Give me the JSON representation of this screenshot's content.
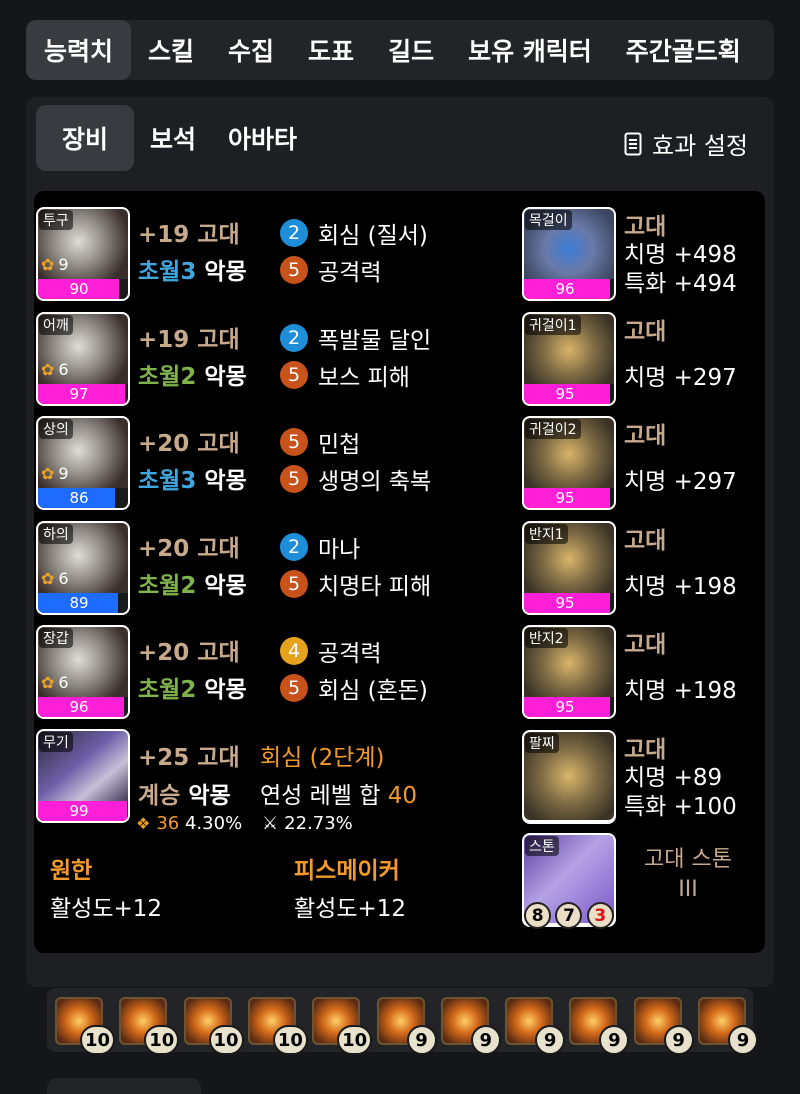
{
  "top_tabs": [
    "능력치",
    "스킬",
    "수집",
    "도표",
    "길드",
    "보유 캐릭터",
    "주간골드획"
  ],
  "sub_tabs": [
    "장비",
    "보석",
    "아바타"
  ],
  "effect_button": "효과 설정",
  "equipment": [
    {
      "slot": "투구",
      "level": "9",
      "quality": 90,
      "bar_color": "#ff1fd6",
      "upgrade": "+19",
      "grade": "고대",
      "transcend": "초월3",
      "transcend_color": "blue",
      "elixir_set": "악몽",
      "engravings": [
        {
          "level": "2",
          "name": "회심 (질서)",
          "color": "b"
        },
        {
          "level": "5",
          "name": "공격력",
          "color": "o"
        }
      ]
    },
    {
      "slot": "어깨",
      "level": "6",
      "quality": 97,
      "bar_color": "#ff1fd6",
      "upgrade": "+19",
      "grade": "고대",
      "transcend": "초월2",
      "transcend_color": "green",
      "elixir_set": "악몽",
      "engravings": [
        {
          "level": "2",
          "name": "폭발물 달인",
          "color": "b"
        },
        {
          "level": "5",
          "name": "보스 피해",
          "color": "o"
        }
      ]
    },
    {
      "slot": "상의",
      "level": "9",
      "quality": 86,
      "bar_color": "#1e6bff",
      "upgrade": "+20",
      "grade": "고대",
      "transcend": "초월3",
      "transcend_color": "blue",
      "elixir_set": "악몽",
      "engravings": [
        {
          "level": "5",
          "name": "민첩",
          "color": "o"
        },
        {
          "level": "5",
          "name": "생명의 축복",
          "color": "o"
        }
      ]
    },
    {
      "slot": "하의",
      "level": "6",
      "quality": 89,
      "bar_color": "#1e6bff",
      "upgrade": "+20",
      "grade": "고대",
      "transcend": "초월2",
      "transcend_color": "green",
      "elixir_set": "악몽",
      "engravings": [
        {
          "level": "2",
          "name": "마나",
          "color": "b"
        },
        {
          "level": "5",
          "name": "치명타 피해",
          "color": "o"
        }
      ]
    },
    {
      "slot": "장갑",
      "level": "6",
      "quality": 96,
      "bar_color": "#ff1fd6",
      "upgrade": "+20",
      "grade": "고대",
      "transcend": "초월2",
      "transcend_color": "green",
      "elixir_set": "악몽",
      "engravings": [
        {
          "level": "4",
          "name": "공격력",
          "color": "y"
        },
        {
          "level": "5",
          "name": "회심 (혼돈)",
          "color": "o"
        }
      ]
    }
  ],
  "weapon": {
    "slot": "무기",
    "quality": 99,
    "bar_color": "#ff1fd6",
    "upgrade": "+25",
    "grade": "고대",
    "effect": "회심 (2단계)",
    "succession": "계승",
    "elixir_set": "악몽",
    "yeonseong_label": "연성 레벨 합",
    "yeonseong_value": "40",
    "stat1_num": "36",
    "stat1_pct": "4.30%",
    "stat2_pct": "22.73%"
  },
  "sets": [
    {
      "name": "원한",
      "value": "활성도+12"
    },
    {
      "name": "피스메이커",
      "value": "활성도+12"
    }
  ],
  "accessories": [
    {
      "slot": "목걸이",
      "quality": 96,
      "grade": "고대",
      "stats": [
        "치명 +498",
        "특화 +494"
      ],
      "img": "neck"
    },
    {
      "slot": "귀걸이1",
      "quality": 95,
      "grade": "고대",
      "stats": [
        "치명 +297"
      ],
      "img": "acc"
    },
    {
      "slot": "귀걸이2",
      "quality": 95,
      "grade": "고대",
      "stats": [
        "치명 +297"
      ],
      "img": "acc"
    },
    {
      "slot": "반지1",
      "quality": 95,
      "grade": "고대",
      "stats": [
        "치명 +198"
      ],
      "img": "acc"
    },
    {
      "slot": "반지2",
      "quality": 95,
      "grade": "고대",
      "stats": [
        "치명 +198"
      ],
      "img": "acc"
    },
    {
      "slot": "팔찌",
      "grade": "고대",
      "stats": [
        "치명 +89",
        "특화 +100"
      ],
      "img": "acc"
    }
  ],
  "stone": {
    "slot": "스톤",
    "name_line1": "고대 스톤",
    "name_line2": "III",
    "nums": [
      "8",
      "7",
      "3"
    ]
  },
  "gems": [
    "10",
    "10",
    "10",
    "10",
    "10",
    "9",
    "9",
    "9",
    "9",
    "9",
    "9"
  ],
  "colors": {
    "quality_magenta": "#ff1fd6",
    "quality_blue": "#1e6bff",
    "grade_tan": "#c7a98c",
    "accent_orange": "#f39a2a"
  }
}
